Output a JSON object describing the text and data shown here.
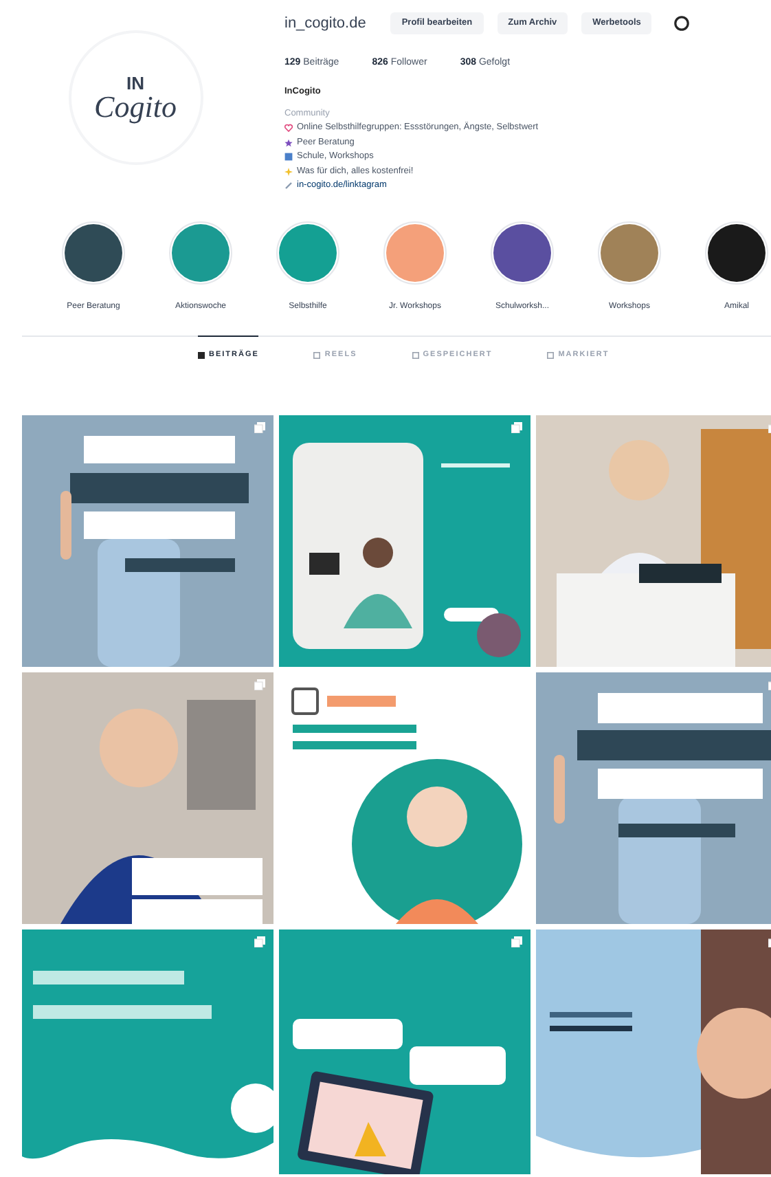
{
  "profile": {
    "avatar_logo": [
      "IN",
      "Cogito"
    ],
    "username": "in_cogito.de",
    "buttons": [
      "Profil bearbeiten",
      "Zum Archiv",
      "Werbetools"
    ],
    "stats": [
      {
        "count": "129",
        "label": "Beiträge"
      },
      {
        "count": "826",
        "label": "Follower"
      },
      {
        "count": "308",
        "label": "Gefolgt"
      }
    ],
    "name": "InCogito",
    "category": "Community",
    "bio": [
      "Online Selbsthilfegruppen: Essstörungen, Ängste, Selbstwert",
      "Peer Beratung",
      "Schule, Workshops",
      "Was für dich, alles kostenfrei!",
      "in-cogito.de/linktagram"
    ]
  },
  "highlights": [
    {
      "label": "Peer Beratung"
    },
    {
      "label": "Aktionswoche"
    },
    {
      "label": "Selbsthilfe"
    },
    {
      "label": "Jr. Workshops"
    },
    {
      "label": "Schulworksh..."
    },
    {
      "label": "Workshops"
    },
    {
      "label": "Amikal"
    }
  ],
  "tabs": [
    {
      "label": "BEITRÄGE",
      "selected": true
    },
    {
      "label": "REELS",
      "selected": false
    },
    {
      "label": "GESPEICHERT",
      "selected": false
    },
    {
      "label": "MARKIERT",
      "selected": false
    }
  ],
  "posts": [
    {
      "kind": "picture",
      "carousel": true
    },
    {
      "kind": "picture",
      "carousel": true
    },
    {
      "kind": "picture",
      "carousel": true
    },
    {
      "kind": "picture",
      "carousel": true
    },
    {
      "kind": "picture",
      "carousel": false
    },
    {
      "kind": "picture",
      "carousel": true
    },
    {
      "kind": "picture",
      "carousel": true
    },
    {
      "kind": "picture",
      "carousel": true
    },
    {
      "kind": "picture",
      "carousel": true
    }
  ]
}
